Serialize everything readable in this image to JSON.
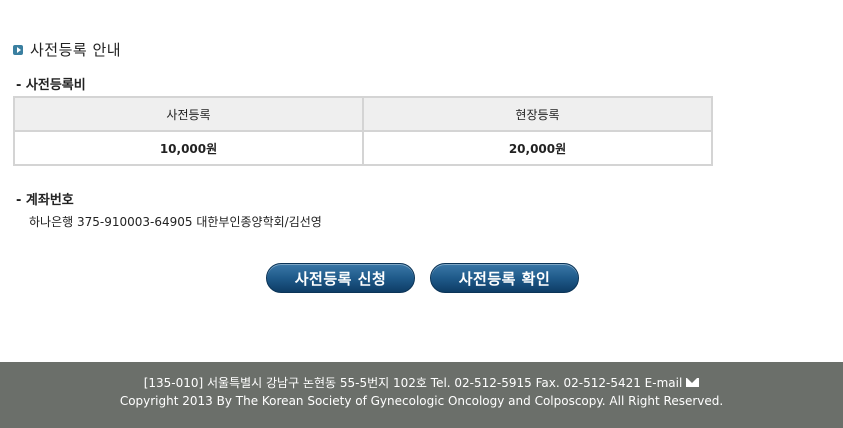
{
  "guide": {
    "title": "사전등록 안내"
  },
  "fee": {
    "heading": "- 사전등록비",
    "columns": [
      "사전등록",
      "현장등록"
    ],
    "values": [
      "10,000원",
      "20,000원"
    ]
  },
  "account": {
    "heading": "- 계좌번호",
    "text": "하나은행 375-910003-64905 대한부인종양학회/김선영"
  },
  "buttons": {
    "apply": "사전등록 신청",
    "confirm": "사전등록 확인"
  },
  "footer": {
    "address": "[135-010] 서울특별시 강남구 논현동 55-5번지 102호 Tel. 02-512-5915 Fax. 02-512-5421 E-mail",
    "copyright": "Copyright 2013 By The Korean Society of Gynecologic Oncology and Colposcopy. All Right Reserved."
  }
}
